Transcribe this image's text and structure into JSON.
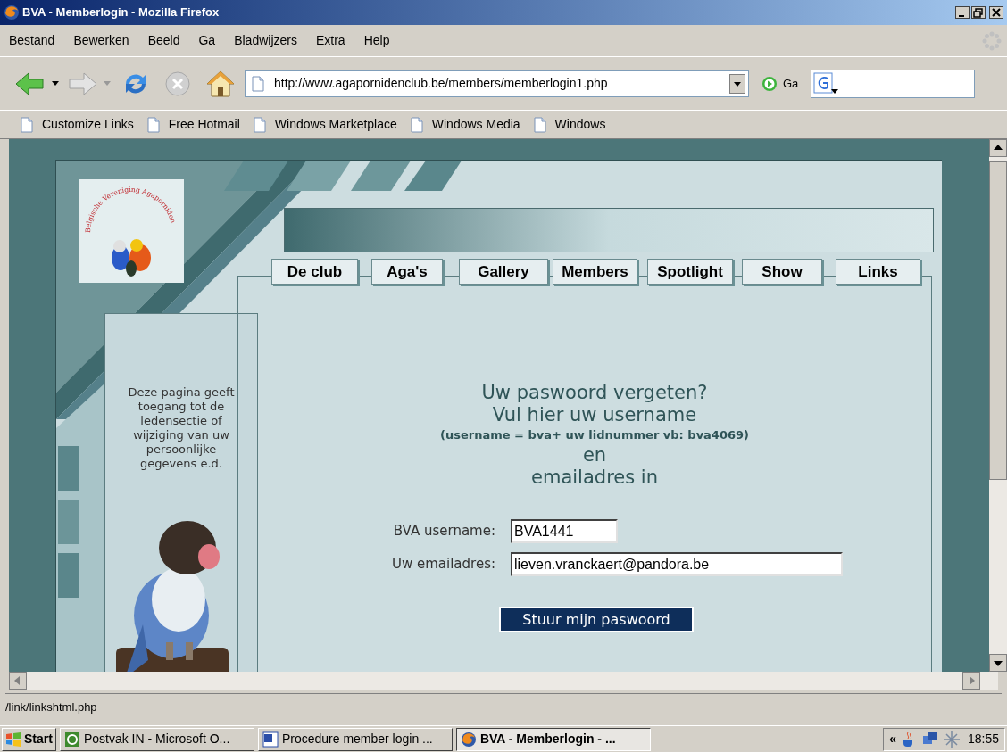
{
  "window": {
    "title": "BVA - Memberlogin - Mozilla Firefox"
  },
  "menu_bar": [
    "Bestand",
    "Bewerken",
    "Beeld",
    "Ga",
    "Bladwijzers",
    "Extra",
    "Help"
  ],
  "toolbar": {
    "address": "http://www.agapornidenclub.be/members/memberlogin1.php",
    "go_label": "Ga"
  },
  "bookmarks": [
    "Customize Links",
    "Free Hotmail",
    "Windows Marketplace",
    "Windows Media",
    "Windows"
  ],
  "page": {
    "logo_text": "Belgische Vereniging Agaporniden",
    "nav_tabs": [
      "De club",
      "Aga's",
      "Gallery",
      "Members",
      "Spotlight",
      "Show",
      "Links"
    ],
    "side_text": "Deze pagina geeft toegang tot de ledensectie of wijziging van uw persoonlijke gegevens e.d.",
    "headings": [
      {
        "kind": "large",
        "text": "Uw paswoord vergeten?"
      },
      {
        "kind": "large",
        "text": "Vul hier uw username"
      },
      {
        "kind": "note",
        "text": "(username = bva+ uw lidnummer vb: bva4069)"
      },
      {
        "kind": "large",
        "text": "en"
      },
      {
        "kind": "large",
        "text": "emailadres in"
      }
    ],
    "fields": [
      {
        "label": "BVA username:",
        "value": "BVA1441"
      },
      {
        "label": "Uw emailadres:",
        "value": "lieven.vranckaert@pandora.be"
      }
    ],
    "submit": "Stuur mijn paswoord"
  },
  "status_bar": "/link/linkshtml.php",
  "taskbar": {
    "start": "Start",
    "tasks": [
      {
        "label": "Postvak IN - Microsoft O...",
        "selected": false
      },
      {
        "label": "Procedure member login ...",
        "selected": false
      },
      {
        "label": "BVA - Memberlogin - ...",
        "selected": true
      }
    ],
    "tray_chevron": "«",
    "clock": "18:55"
  }
}
